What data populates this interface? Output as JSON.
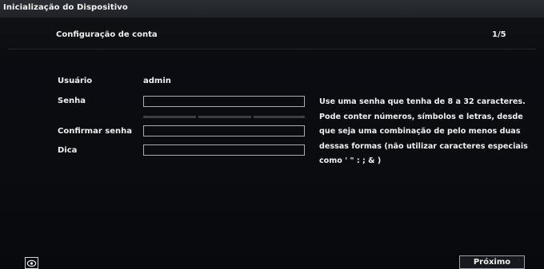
{
  "window": {
    "title": "Inicialização do Dispositivo"
  },
  "header": {
    "section_title": "Configuração de conta",
    "step": "1/5"
  },
  "form": {
    "user_label": "Usuário",
    "user_value": "admin",
    "password_label": "Senha",
    "password_value": "",
    "password_strength_segments": 3,
    "confirm_label": "Confirmar senha",
    "confirm_value": "",
    "hint_label": "Dica",
    "hint_value": ""
  },
  "help_text": "Use uma senha que tenha de 8 a 32 caracteres. Pode conter números, símbolos e letras, desde que seja uma combinação de pelo menos duas dessas formas (não utilizar caracteres especiais como ' \" : ; & )",
  "footer": {
    "next_label": "Próximo",
    "eye_icon": "eye-icon"
  },
  "colors": {
    "background": "#0a0c10",
    "field_border": "#a7adb5",
    "titlebar": "#25282e"
  }
}
